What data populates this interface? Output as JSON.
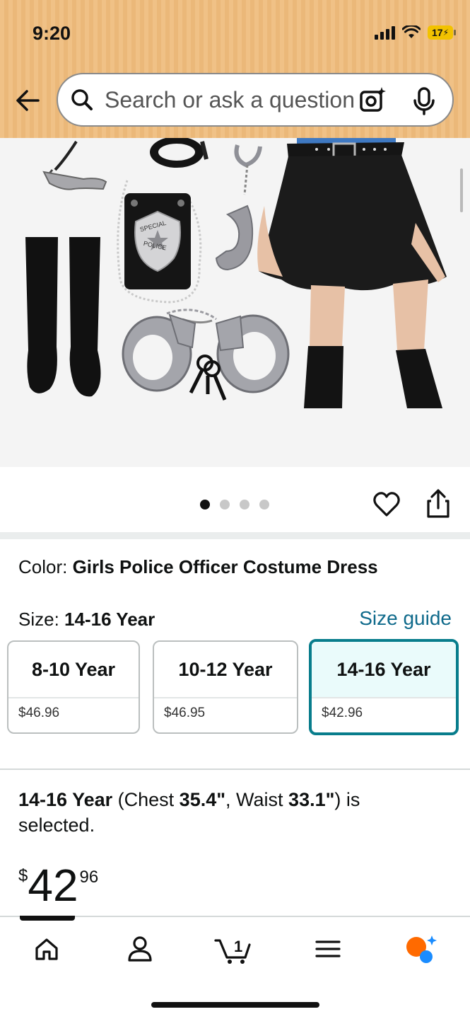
{
  "status_bar": {
    "time": "9:20",
    "battery": "17"
  },
  "search": {
    "placeholder": "Search or ask a question"
  },
  "icons": {
    "back": "arrow-left-icon",
    "search": "search-icon",
    "camera": "camera-sparkle-icon",
    "mic": "microphone-icon",
    "heart": "heart-icon",
    "share": "share-icon",
    "home": "home-icon",
    "account": "person-icon",
    "cart": "cart-icon",
    "menu": "hamburger-menu-icon",
    "rufus": "rufus-assistant-icon"
  },
  "image_carousel": {
    "total_images": 4,
    "active_index": 0,
    "badge_text_line1": "SPECIAL",
    "badge_text_line2": "POLICE"
  },
  "product": {
    "color_label": "Color: ",
    "color_value": "Girls Police Officer Costume Dress",
    "size_label": "Size: ",
    "size_value": "14-16 Year",
    "size_guide": "Size guide",
    "sizes": [
      {
        "name": "8-10 Year",
        "price": "$46.96",
        "selected": false
      },
      {
        "name": "10-12 Year",
        "price": "$46.95",
        "selected": false
      },
      {
        "name": "14-16 Year",
        "price": "$42.96",
        "selected": true
      }
    ],
    "selection_summary": {
      "size": "14-16 Year",
      "part1": " (Chest ",
      "chest": "35.4\"",
      "part2": ", Waist ",
      "waist": "33.1\"",
      "part3": ") is selected."
    },
    "price": {
      "currency": "$",
      "whole": "42",
      "fraction": "96"
    }
  },
  "bottom_nav": {
    "cart_count": "1",
    "active": "home"
  },
  "colors": {
    "header_bg": "#f0c186",
    "link": "#0f6a8b",
    "selected_border": "#087d8c",
    "selected_bg": "#eafbfb",
    "rufus_orange": "#ff6a00",
    "rufus_blue": "#1a8cff"
  }
}
